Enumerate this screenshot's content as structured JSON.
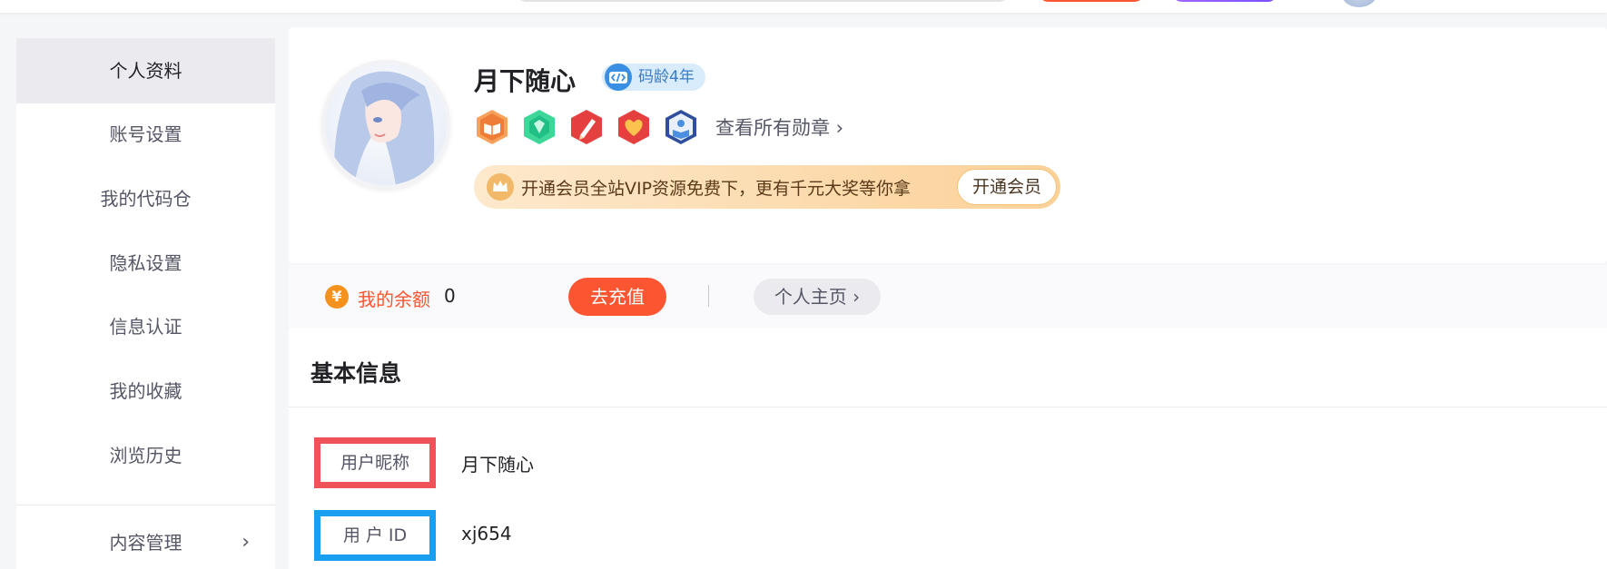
{
  "sidebar": {
    "items": [
      {
        "label": "个人资料",
        "active": true
      },
      {
        "label": "账号设置"
      },
      {
        "label": "我的代码仓"
      },
      {
        "label": "隐私设置"
      },
      {
        "label": "信息认证"
      },
      {
        "label": "我的收藏"
      },
      {
        "label": "浏览历史"
      }
    ],
    "content_manage": {
      "label": "内容管理",
      "chevron": "›"
    }
  },
  "profile": {
    "username": "月下随心",
    "code_age": "码龄4年",
    "medals": [
      "book-medal-icon",
      "gem-medal-icon",
      "pen-medal-icon",
      "heart-medal-icon",
      "reader-medal-icon"
    ],
    "view_medals": "查看所有勋章 ›",
    "vip": {
      "text": "开通会员全站VIP资源免费下，更有千元大奖等你拿",
      "button": "开通会员"
    }
  },
  "balance": {
    "icon": "¥",
    "label": "我的余额",
    "value": "0",
    "recharge": "去充值",
    "homepage": "个人主页 ›"
  },
  "basic_info": {
    "title": "基本信息",
    "fields": [
      {
        "label": "用户昵称",
        "value": "月下随心"
      },
      {
        "label": "用 户  ID",
        "value": "xj654"
      }
    ]
  },
  "colors": {
    "accent": "#fc5531",
    "highlight_red": "#f0525a",
    "highlight_blue": "#1a9ff0"
  }
}
